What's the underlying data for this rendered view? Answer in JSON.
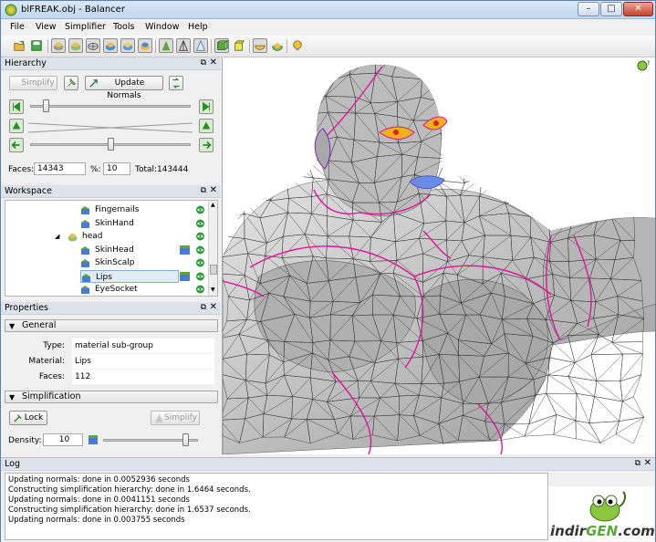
{
  "window": {
    "title": "blFREAK.obj - Balancer",
    "buttons": {
      "minimize": "–",
      "maximize": "□",
      "close": "✕"
    }
  },
  "menu": [
    "File",
    "View",
    "Simplifier",
    "Tools",
    "Window",
    "Help"
  ],
  "toolbar": {
    "icons": [
      "open-icon",
      "save-icon",
      "mesh-a-icon",
      "mesh-b-icon",
      "mesh-c-icon",
      "mesh-d-icon",
      "mesh-e-icon",
      "mesh-f-icon",
      "cone-a-icon",
      "cone-b-icon",
      "cone-c-icon",
      "cube-a-icon",
      "cube-b-icon",
      "bowl-a-icon",
      "bowl-b-icon",
      "lightbulb-icon"
    ]
  },
  "hierarchy": {
    "title": "Hierarchy",
    "float": "⧉",
    "close": "✕",
    "simplify_label": "Simplify",
    "update_normals_label": "Update Normals",
    "faces_label": "Faces:",
    "faces_value": "14343",
    "percent_label": "%:",
    "percent_value": "10",
    "total_label": "Total:",
    "total_value": "143444",
    "slider1_level": 0.08,
    "slider2_level": 0.5
  },
  "workspace": {
    "title": "Workspace",
    "float": "⧉",
    "close": "✕",
    "items": [
      {
        "label": "Fingernails",
        "depth": 2,
        "selected": false,
        "has_mat": false
      },
      {
        "label": "SkinHand",
        "depth": 2,
        "selected": false,
        "has_mat": false
      },
      {
        "label": "head",
        "depth": 1,
        "selected": false,
        "has_mat": false,
        "expanded": true
      },
      {
        "label": "SkinHead",
        "depth": 2,
        "selected": false,
        "has_mat": true
      },
      {
        "label": "SkinScalp",
        "depth": 2,
        "selected": false,
        "has_mat": false
      },
      {
        "label": "Lips",
        "depth": 2,
        "selected": true,
        "has_mat": true
      },
      {
        "label": "EyeSocket",
        "depth": 2,
        "selected": false,
        "has_mat": false
      }
    ]
  },
  "properties": {
    "title": "Properties",
    "float": "⧉",
    "close": "✕",
    "general_label": "General",
    "type_label": "Type:",
    "type_value": "material sub-group",
    "material_label": "Material:",
    "material_value": "Lips",
    "faces_label": "Faces:",
    "faces_value": "112",
    "simplification_label": "Simplification",
    "lock_label": "Lock",
    "simplify_label": "Simplify",
    "density_label": "Density:",
    "density_value": "10",
    "density_level": 0.9
  },
  "log": {
    "title": "Log",
    "float": "⧉",
    "close": "✕",
    "lines": [
      "Updating normals:  done in 0.0052936 seconds",
      "Constructing simplification hierarchy: done in 1.6464 seconds.",
      "Updating normals:  done in 0.0041151 seconds",
      "Constructing simplification hierarchy: done in 1.6537 seconds.",
      "Updating normals:  done in 0.003755 seconds"
    ]
  },
  "watermark": {
    "brand_a": "indir",
    "brand_b": "GEN",
    "brand_c": ".com"
  },
  "colors": {
    "accent": "#e0159a",
    "mesh": "#c4c4c4",
    "lips": "#6a8ce8"
  }
}
